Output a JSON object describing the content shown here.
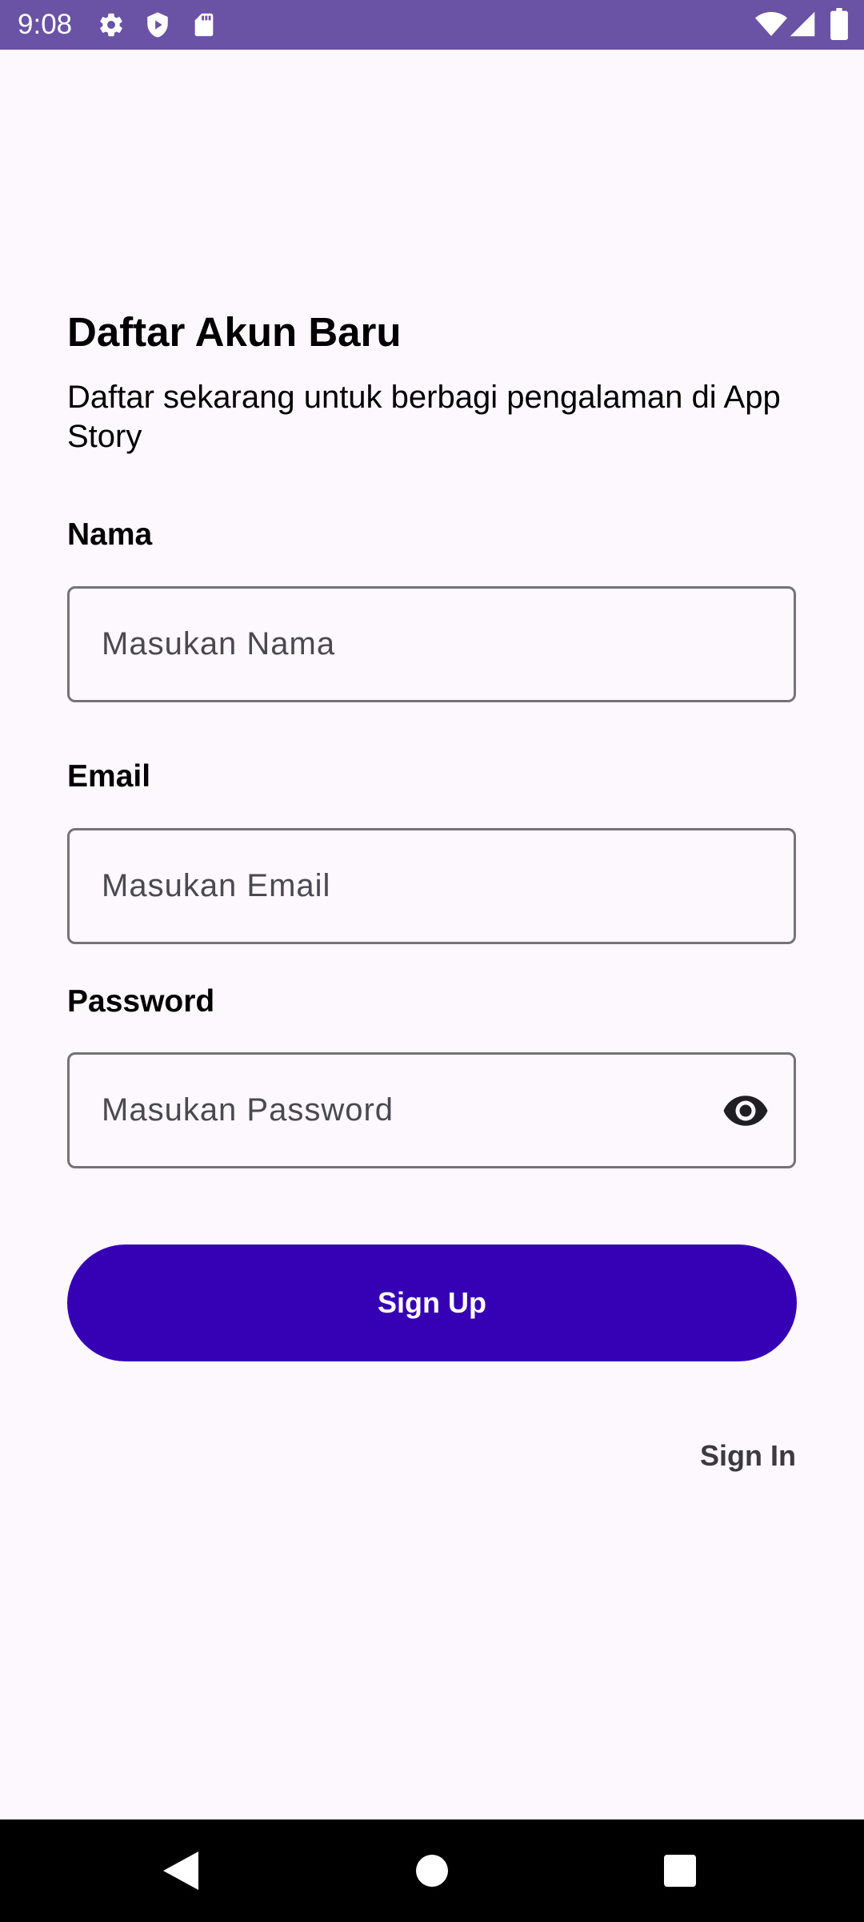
{
  "status_bar": {
    "time": "9:08",
    "left_icons": [
      "gear-icon",
      "shield-play-icon",
      "sd-card-icon"
    ],
    "right_icons": [
      "wifi-icon",
      "cellular-signal-icon",
      "battery-icon"
    ]
  },
  "signup": {
    "title": "Daftar Akun Baru",
    "subtitle": "Daftar sekarang untuk berbagi pengalaman di App Story",
    "name_label": "Nama",
    "name_placeholder": "Masukan Nama",
    "email_label": "Email",
    "email_placeholder": "Masukan Email",
    "password_label": "Password",
    "password_placeholder": "Masukan Password",
    "password_toggle_icon": "eye-icon",
    "signup_button_label": "Sign Up",
    "signin_link_label": "Sign In"
  },
  "nav_bar": {
    "buttons": [
      "back-icon",
      "home-icon",
      "recents-icon"
    ]
  },
  "colors": {
    "status_bar": "#6A53A5",
    "background": "#FDF7FE",
    "primary_button": "#3600B4",
    "input_border": "#75737A",
    "nav_bar": "#000000"
  }
}
